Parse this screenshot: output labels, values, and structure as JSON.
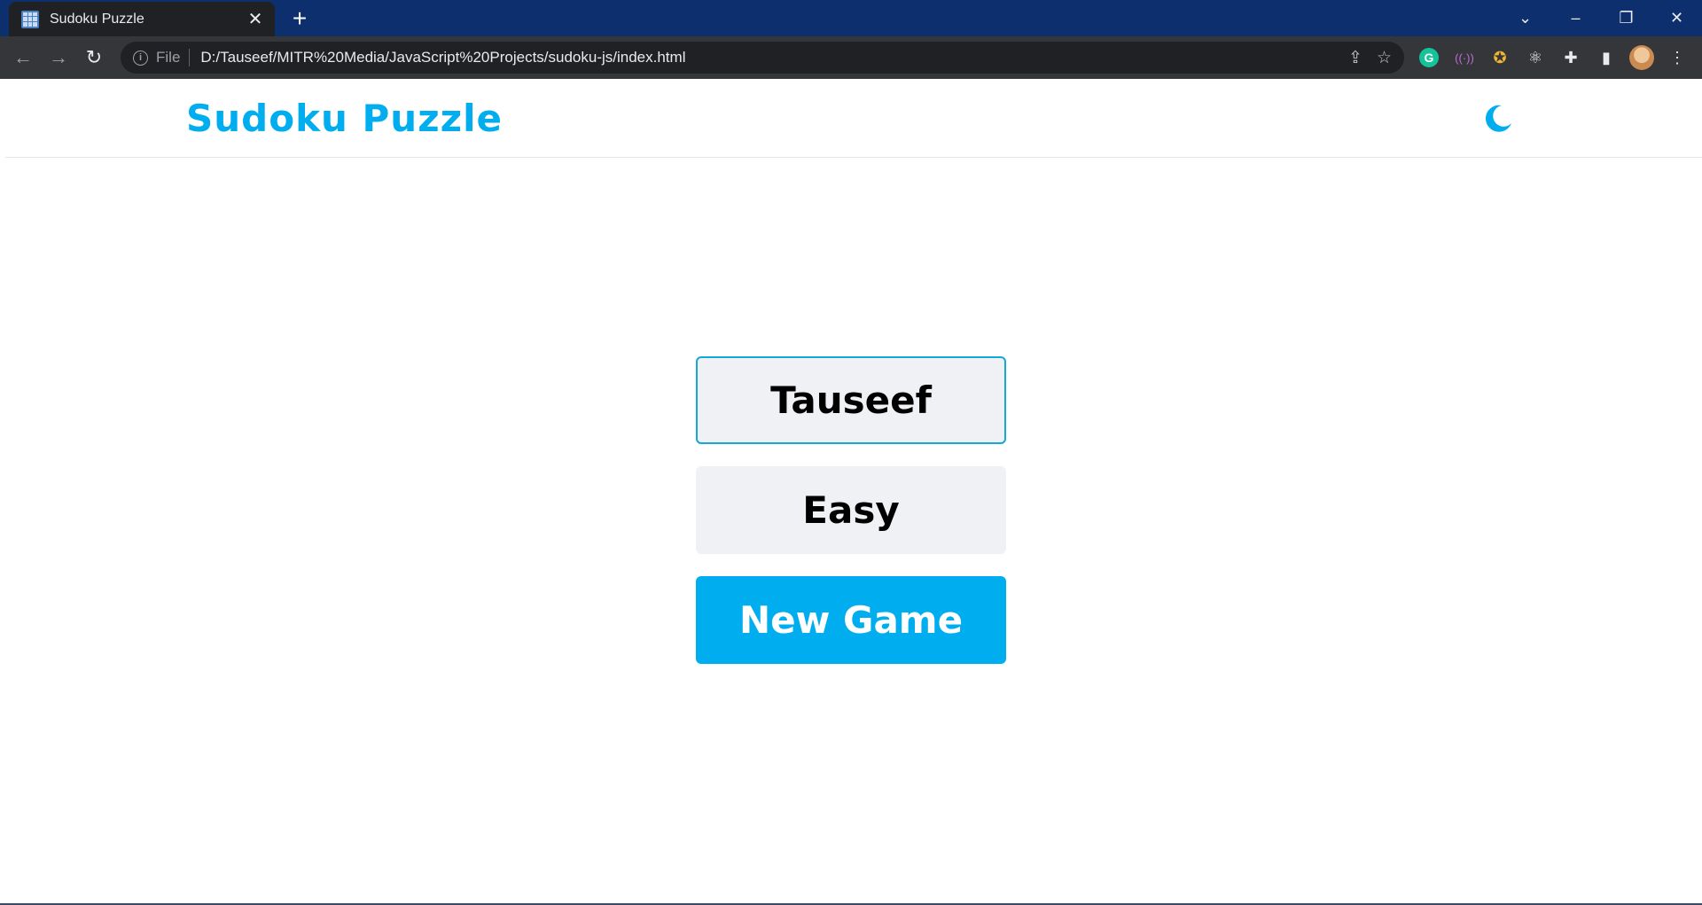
{
  "browser": {
    "tab_title": "Sudoku Puzzle",
    "tab_close": "✕",
    "new_tab": "+",
    "window_controls": {
      "dropdown": "⌄",
      "minimize": "–",
      "restore": "❐",
      "close": "✕"
    },
    "nav": {
      "back": "←",
      "forward": "→",
      "reload": "↻"
    },
    "omnibox": {
      "info": "i",
      "scheme_label": "File",
      "url": "D:/Tauseef/MITR%20Media/JavaScript%20Projects/sudoku-js/index.html",
      "share_icon": "⇪",
      "star_icon": "☆"
    },
    "extensions": {
      "grammarly": "G",
      "broadcast": "((·))",
      "colorful": "✪",
      "react": "⚛",
      "puzzle": "✚",
      "sidepanel": "▮",
      "menu": "⋮"
    }
  },
  "app": {
    "title": "Sudoku Puzzle",
    "theme_icon": "moon-icon",
    "accent_color": "#00aeef",
    "name_input": {
      "value": "Tauseef",
      "placeholder": ""
    },
    "level_button": "Easy",
    "new_game_button": "New Game"
  }
}
